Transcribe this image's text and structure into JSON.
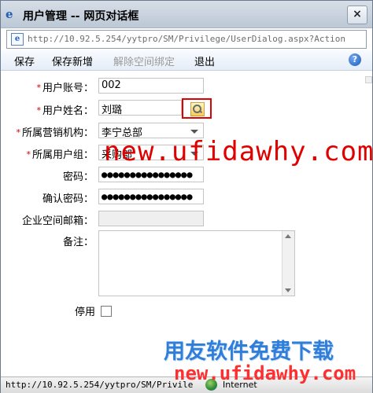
{
  "window": {
    "title": "用户管理 -- 网页对话框",
    "close_label": "×",
    "address": "http://10.92.5.254/yytpro/SM/Privilege/UserDialog.aspx?Action"
  },
  "toolbar": {
    "save": "保存",
    "save_new": "保存新增",
    "unbind": "解除空间绑定",
    "exit": "退出",
    "help": "?"
  },
  "form": {
    "account_label": "用户账号：",
    "account_value": "002",
    "name_label": "用户姓名：",
    "name_value": "刘璐",
    "org_label": "所属营销机构：",
    "org_value": "李宁总部",
    "group_label": "所属用户组：",
    "group_value": "采购部",
    "password_label": "密码：",
    "password_value": "●●●●●●●●●●●●●●●●",
    "confirm_label": "确认密码：",
    "confirm_value": "●●●●●●●●●●●●●●●●",
    "email_label": "企业空间邮箱：",
    "email_value": "",
    "remark_label": "备注：",
    "disabled_label": "停用"
  },
  "watermarks": {
    "top": "new.ufidawhy.com",
    "bottom_cn": "用友软件免费下载",
    "bottom_url": "new.ufidawhy.com"
  },
  "status": {
    "url": "http://10.92.5.254/yytpro/SM/Privile",
    "zone": "Internet"
  },
  "colors": {
    "required": "#d00000",
    "highlight": "#e00000",
    "watermark_blue": "#2f7ed9"
  }
}
